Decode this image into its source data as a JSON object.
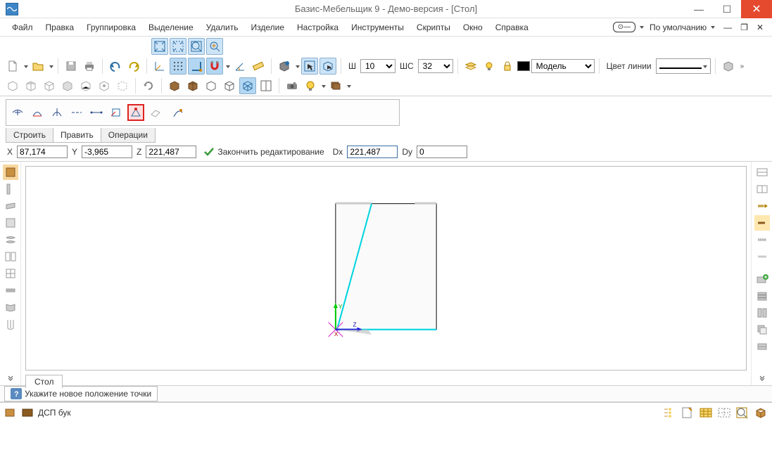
{
  "window": {
    "title": "Базис-Мебельщик 9 - Демо-версия - [Стол]"
  },
  "menubar": [
    "Файл",
    "Правка",
    "Группировка",
    "Выделение",
    "Удалить",
    "Изделие",
    "Настройка",
    "Инструменты",
    "Скрипты",
    "Окно",
    "Справка"
  ],
  "right_menu": {
    "mode_label": "По умолчанию"
  },
  "row3": {
    "width_label": "Ш",
    "width_value": "10",
    "shs_label": "ШС",
    "shs_value": "32",
    "model_label": "Модель",
    "line_color_label": "Цвет линии"
  },
  "tabs": {
    "t1": "Строить",
    "t2": "Править",
    "t3": "Операции"
  },
  "coords": {
    "x_label": "X",
    "x_val": "87,174",
    "y_label": "Y",
    "y_val": "-3,965",
    "z_label": "Z",
    "z_val": "221,487",
    "finish": "Закончить редактирование",
    "dx_label": "Dx",
    "dx_val": "221,487",
    "dy_label": "Dy",
    "dy_val": "0"
  },
  "bottom_tab": "Стол",
  "hint": "Укажите новое положение точки",
  "status": {
    "material": "ДСП бук"
  }
}
